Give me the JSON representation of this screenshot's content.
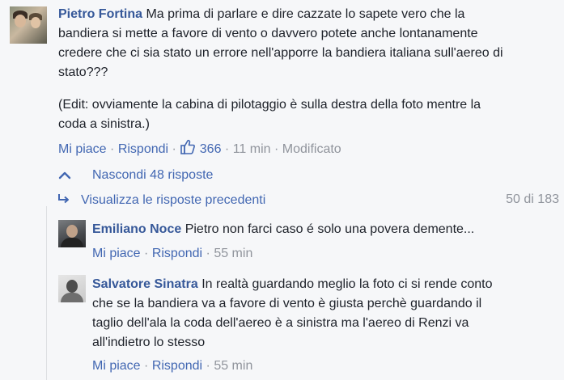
{
  "top_comment": {
    "author": "Pietro Fortina",
    "text_lines": [
      "Ma prima di parlare e dire cazzate lo sapete vero che la",
      "bandiera si mette a favore di vento o davvero potete anche lontanamente",
      "credere che ci sia stato un errore nell'apporre la bandiera italiana sull'aereo di",
      "stato???"
    ],
    "edit_lines": [
      "(Edit: ovviamente la cabina di pilotaggio è sulla destra della foto mentre la",
      "coda a sinistra.)"
    ],
    "like_label": "Mi piace",
    "reply_label": "Rispondi",
    "like_count": "366",
    "time": "11 min",
    "edited_label": "Modificato"
  },
  "replies_toggle": {
    "hide_label": "Nascondi 48 risposte",
    "view_previous_label": "Visualizza le risposte precedenti",
    "pager_text": "50 di 183"
  },
  "replies": [
    {
      "author": "Emiliano Noce",
      "text_lines": [
        "Pietro non farci caso é solo una povera demente..."
      ],
      "like_label": "Mi piace",
      "reply_label": "Rispondi",
      "time": "55 min"
    },
    {
      "author": "Salvatore Sinatra",
      "text_lines": [
        "In realtà guardando meglio la foto ci si rende conto",
        "che se la bandiera va a favore di vento è giusta perchè guardando il",
        "taglio dell'ala la coda dell'aereo è a sinistra ma l'aereo di Renzi va",
        "all'indietro lo stesso"
      ],
      "like_label": "Mi piace",
      "reply_label": "Rispondi",
      "time": "55 min"
    }
  ],
  "colors": {
    "link": "#4267b2",
    "author": "#365899",
    "muted": "#90949c",
    "text": "#1d2129",
    "background": "#f6f7f9"
  }
}
